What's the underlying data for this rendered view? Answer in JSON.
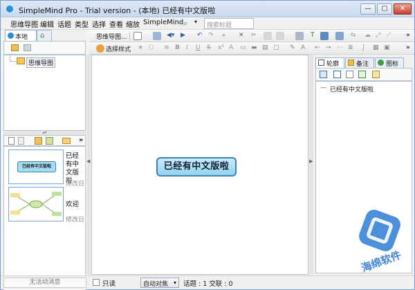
{
  "window": {
    "title": "SimpleMind Pro - Trial version - (本地) 已经有中文版啦",
    "buttons": {
      "minimize": "—",
      "maximize": "▢",
      "close": "✕"
    }
  },
  "menu": {
    "items": [
      "思维导图",
      "编辑",
      "话题",
      "类型",
      "选择",
      "查看",
      "缩放",
      "SimpleMind"
    ],
    "search_placeholder": "搜索标题"
  },
  "toolbar": {
    "mindmap_label": "思维导图...",
    "style_label": "选择样式"
  },
  "left_panel": {
    "tab_local": "本地",
    "tree_item": "思维导图",
    "thumbnails": [
      {
        "label": "已经有中文版啦",
        "date": "修改日",
        "mini_title": "已经有中文版啦"
      },
      {
        "label": "欢迎",
        "date": "修改日"
      }
    ]
  },
  "canvas": {
    "central_topic": "已经有中文版啦"
  },
  "right_panel": {
    "tabs": [
      "轮廓",
      "备注",
      "图标"
    ],
    "outline_item": "已经有中文版啦"
  },
  "status": {
    "no_activity": "无活动消息",
    "readonly_label": "只读",
    "autofocus_label": "自动对焦",
    "stats": "话题 : 1 交联 : 0"
  },
  "watermark": {
    "brand": "海绵软件"
  },
  "colors": {
    "accent": "#2a8fd6",
    "node_fill": "#94d2ee",
    "node_border": "#3d7fbf",
    "watermark_blue": "#2d7bd3"
  }
}
